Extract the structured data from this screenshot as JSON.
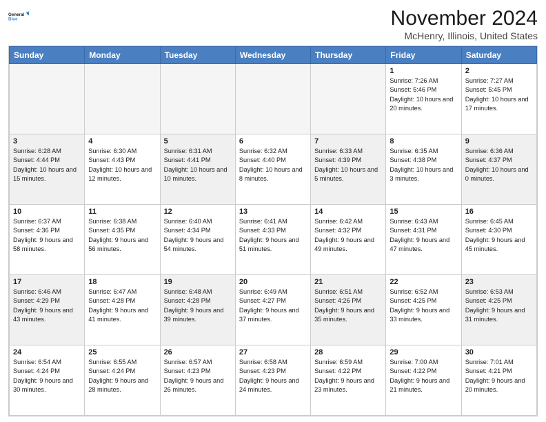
{
  "logo": {
    "line1": "General",
    "line2": "Blue",
    "icon_color": "#4a90d9"
  },
  "title": "November 2024",
  "subtitle": "McHenry, Illinois, United States",
  "days_of_week": [
    "Sunday",
    "Monday",
    "Tuesday",
    "Wednesday",
    "Thursday",
    "Friday",
    "Saturday"
  ],
  "weeks": [
    [
      {
        "day": null,
        "empty": true
      },
      {
        "day": null,
        "empty": true
      },
      {
        "day": null,
        "empty": true
      },
      {
        "day": null,
        "empty": true
      },
      {
        "day": null,
        "empty": true
      },
      {
        "day": 1,
        "sunrise": "7:26 AM",
        "sunset": "5:46 PM",
        "daylight": "10 hours and 20 minutes."
      },
      {
        "day": 2,
        "sunrise": "7:27 AM",
        "sunset": "5:45 PM",
        "daylight": "10 hours and 17 minutes."
      }
    ],
    [
      {
        "day": 3,
        "sunrise": "6:28 AM",
        "sunset": "4:44 PM",
        "daylight": "10 hours and 15 minutes."
      },
      {
        "day": 4,
        "sunrise": "6:30 AM",
        "sunset": "4:43 PM",
        "daylight": "10 hours and 12 minutes."
      },
      {
        "day": 5,
        "sunrise": "6:31 AM",
        "sunset": "4:41 PM",
        "daylight": "10 hours and 10 minutes."
      },
      {
        "day": 6,
        "sunrise": "6:32 AM",
        "sunset": "4:40 PM",
        "daylight": "10 hours and 8 minutes."
      },
      {
        "day": 7,
        "sunrise": "6:33 AM",
        "sunset": "4:39 PM",
        "daylight": "10 hours and 5 minutes."
      },
      {
        "day": 8,
        "sunrise": "6:35 AM",
        "sunset": "4:38 PM",
        "daylight": "10 hours and 3 minutes."
      },
      {
        "day": 9,
        "sunrise": "6:36 AM",
        "sunset": "4:37 PM",
        "daylight": "10 hours and 0 minutes."
      }
    ],
    [
      {
        "day": 10,
        "sunrise": "6:37 AM",
        "sunset": "4:36 PM",
        "daylight": "9 hours and 58 minutes."
      },
      {
        "day": 11,
        "sunrise": "6:38 AM",
        "sunset": "4:35 PM",
        "daylight": "9 hours and 56 minutes."
      },
      {
        "day": 12,
        "sunrise": "6:40 AM",
        "sunset": "4:34 PM",
        "daylight": "9 hours and 54 minutes."
      },
      {
        "day": 13,
        "sunrise": "6:41 AM",
        "sunset": "4:33 PM",
        "daylight": "9 hours and 51 minutes."
      },
      {
        "day": 14,
        "sunrise": "6:42 AM",
        "sunset": "4:32 PM",
        "daylight": "9 hours and 49 minutes."
      },
      {
        "day": 15,
        "sunrise": "6:43 AM",
        "sunset": "4:31 PM",
        "daylight": "9 hours and 47 minutes."
      },
      {
        "day": 16,
        "sunrise": "6:45 AM",
        "sunset": "4:30 PM",
        "daylight": "9 hours and 45 minutes."
      }
    ],
    [
      {
        "day": 17,
        "sunrise": "6:46 AM",
        "sunset": "4:29 PM",
        "daylight": "9 hours and 43 minutes."
      },
      {
        "day": 18,
        "sunrise": "6:47 AM",
        "sunset": "4:28 PM",
        "daylight": "9 hours and 41 minutes."
      },
      {
        "day": 19,
        "sunrise": "6:48 AM",
        "sunset": "4:28 PM",
        "daylight": "9 hours and 39 minutes."
      },
      {
        "day": 20,
        "sunrise": "6:49 AM",
        "sunset": "4:27 PM",
        "daylight": "9 hours and 37 minutes."
      },
      {
        "day": 21,
        "sunrise": "6:51 AM",
        "sunset": "4:26 PM",
        "daylight": "9 hours and 35 minutes."
      },
      {
        "day": 22,
        "sunrise": "6:52 AM",
        "sunset": "4:25 PM",
        "daylight": "9 hours and 33 minutes."
      },
      {
        "day": 23,
        "sunrise": "6:53 AM",
        "sunset": "4:25 PM",
        "daylight": "9 hours and 31 minutes."
      }
    ],
    [
      {
        "day": 24,
        "sunrise": "6:54 AM",
        "sunset": "4:24 PM",
        "daylight": "9 hours and 30 minutes."
      },
      {
        "day": 25,
        "sunrise": "6:55 AM",
        "sunset": "4:24 PM",
        "daylight": "9 hours and 28 minutes."
      },
      {
        "day": 26,
        "sunrise": "6:57 AM",
        "sunset": "4:23 PM",
        "daylight": "9 hours and 26 minutes."
      },
      {
        "day": 27,
        "sunrise": "6:58 AM",
        "sunset": "4:23 PM",
        "daylight": "9 hours and 24 minutes."
      },
      {
        "day": 28,
        "sunrise": "6:59 AM",
        "sunset": "4:22 PM",
        "daylight": "9 hours and 23 minutes."
      },
      {
        "day": 29,
        "sunrise": "7:00 AM",
        "sunset": "4:22 PM",
        "daylight": "9 hours and 21 minutes."
      },
      {
        "day": 30,
        "sunrise": "7:01 AM",
        "sunset": "4:21 PM",
        "daylight": "9 hours and 20 minutes."
      }
    ]
  ]
}
